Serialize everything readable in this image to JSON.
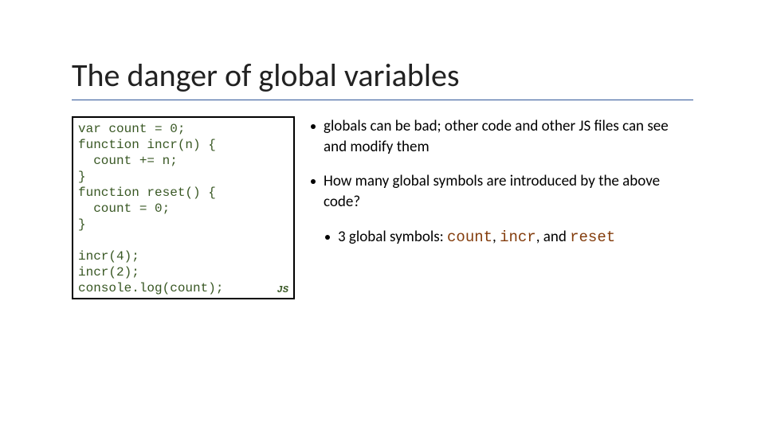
{
  "title": "The danger of global variables",
  "code": "var count = 0;\nfunction incr(n) {\n  count += n;\n}\nfunction reset() {\n  count = 0;\n}\n\nincr(4);\nincr(2);\nconsole.log(count);",
  "code_tag": "JS",
  "bullets": {
    "b1": "globals can be bad; other code and other JS files can see and modify them",
    "b2": "How many global symbols are introduced by the above code?",
    "b3_prefix": "3 global symbols: ",
    "sym1": "count",
    "sep1": ", ",
    "sym2": "incr",
    "sep2": ", and ",
    "sym3": "reset"
  }
}
